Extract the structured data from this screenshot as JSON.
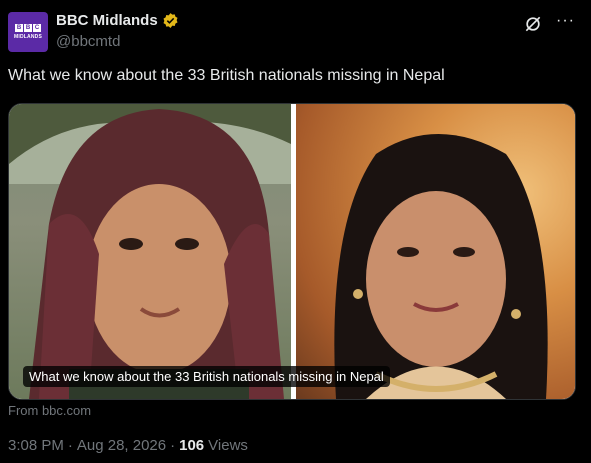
{
  "account": {
    "display_name": "BBC Midlands",
    "handle": "@bbcmtd",
    "avatar_letters": [
      "B",
      "B",
      "C"
    ],
    "avatar_label": "MIDLANDS"
  },
  "tweet": {
    "text": "What we know about the 33 British nationals missing in Nepal"
  },
  "card": {
    "caption": "What we know about the 33 British nationals missing in Nepal",
    "source": "From bbc.com"
  },
  "meta": {
    "time": "3:08 PM",
    "separator1": "·",
    "date": "Aug 28, 2026",
    "separator2": "·",
    "views_count": "106",
    "views_label": "Views"
  },
  "icons": {
    "verified": "verified-badge-icon",
    "grok": "grok-icon",
    "more": "more-options-icon"
  },
  "colors": {
    "background": "#000000",
    "text": "#e7e9ea",
    "secondary_text": "#71767b",
    "verified_gold": "#e2b719",
    "avatar_purple": "#5b2aa6"
  }
}
